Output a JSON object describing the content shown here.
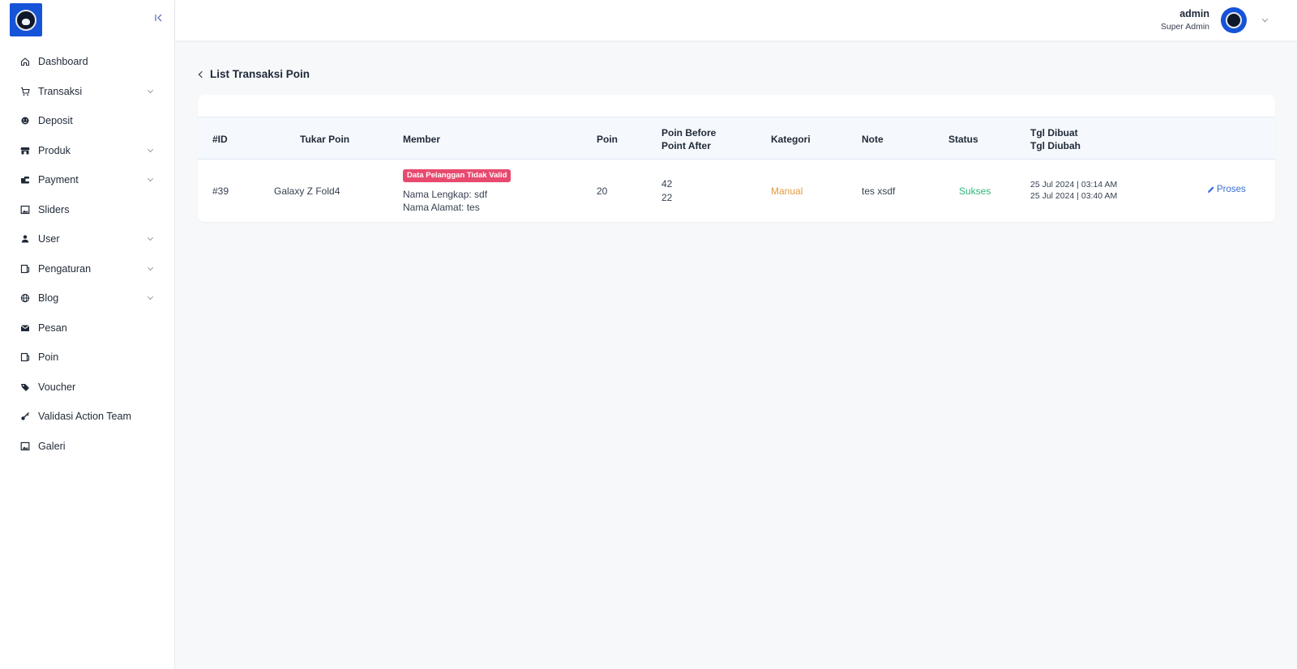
{
  "sidebar": {
    "items": [
      {
        "label": "Dashboard",
        "icon": "home-icon",
        "has_children": false
      },
      {
        "label": "Transaksi",
        "icon": "cart-icon",
        "has_children": true
      },
      {
        "label": "Deposit",
        "icon": "deposit-icon",
        "has_children": false
      },
      {
        "label": "Produk",
        "icon": "store-icon",
        "has_children": true
      },
      {
        "label": "Payment",
        "icon": "wallet-icon",
        "has_children": true
      },
      {
        "label": "Sliders",
        "icon": "image-icon",
        "has_children": false
      },
      {
        "label": "User",
        "icon": "person-icon",
        "has_children": true
      },
      {
        "label": "Pengaturan",
        "icon": "settings-panel-icon",
        "has_children": true
      },
      {
        "label": "Blog",
        "icon": "globe-icon",
        "has_children": true
      },
      {
        "label": "Pesan",
        "icon": "mail-icon",
        "has_children": false
      },
      {
        "label": "Poin",
        "icon": "points-icon",
        "has_children": false
      },
      {
        "label": "Voucher",
        "icon": "tag-icon",
        "has_children": false
      },
      {
        "label": "Validasi Action Team",
        "icon": "key-icon",
        "has_children": false
      },
      {
        "label": "Galeri",
        "icon": "gallery-icon",
        "has_children": false
      }
    ]
  },
  "header": {
    "user_name": "admin",
    "user_role": "Super Admin"
  },
  "page": {
    "title": "List Transaksi Poin"
  },
  "table": {
    "headers": {
      "id": "#ID",
      "tukar_poin": "Tukar Poin",
      "member": "Member",
      "poin": "Poin",
      "poin_before": "Poin Before",
      "point_after": "Point After",
      "kategori": "Kategori",
      "note": "Note",
      "status": "Status",
      "tgl_dibuat": "Tgl Dibuat",
      "tgl_diubah": "Tgl Diubah"
    },
    "rows": [
      {
        "id": "#39",
        "tukar_poin": "Galaxy Z Fold4",
        "badge": "Data Pelanggan Tidak Valid",
        "nama_lengkap": "Nama Lengkap: sdf",
        "nama_alamat": "Nama Alamat: tes",
        "poin": "20",
        "poin_before": "42",
        "point_after": "22",
        "kategori": "Manual",
        "note": "tes xsdf",
        "status": "Sukses",
        "tgl_dibuat": "25 Jul 2024 | 03:14 AM",
        "tgl_diubah": "25 Jul 2024 | 03:40 AM",
        "action": "Proses"
      }
    ]
  },
  "colors": {
    "brand_blue": "#1553d8",
    "badge_red": "#e84a6f",
    "kategori_orange": "#e29a3d",
    "status_green": "#2fb57a",
    "link_blue": "#3b6fd6"
  }
}
